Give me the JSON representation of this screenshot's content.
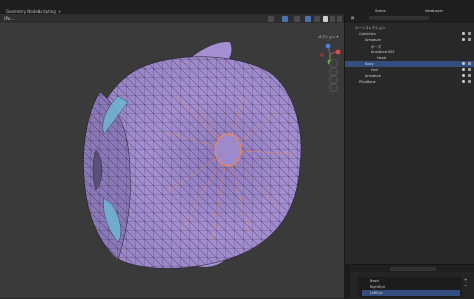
{
  "workspace_tabs": [
    "Geometry Nodes",
    "Scripting"
  ],
  "viewport": {
    "mode_label": "(Po...",
    "options_label": "オプション ▾",
    "axes": [
      "X",
      "Y",
      "Z"
    ]
  },
  "outliner": {
    "scene_label": "Scene",
    "view_layer_label": "ViewLayer",
    "header_label": "シーンコレクション",
    "rows": [
      {
        "label": "Collection",
        "indent": 0,
        "selected": false
      },
      {
        "label": "Armature",
        "indent": 1,
        "selected": false
      },
      {
        "label": "ポーズ",
        "indent": 2,
        "selected": false
      },
      {
        "label": "Armature.002",
        "indent": 2,
        "selected": false
      },
      {
        "label": "Head",
        "indent": 3,
        "selected": false
      },
      {
        "label": "Body",
        "indent": 1,
        "selected": true
      },
      {
        "label": "Hair",
        "indent": 2,
        "selected": false
      },
      {
        "label": "Armature",
        "indent": 1,
        "selected": false
      },
      {
        "label": "PhysBone",
        "indent": 0,
        "selected": false
      }
    ]
  },
  "properties": {
    "shape_keys": [
      {
        "label": "Basis",
        "selected": false
      },
      {
        "label": "RightEye",
        "selected": false
      },
      {
        "label": "LeftEye",
        "selected": true
      }
    ]
  },
  "colors": {
    "mesh": "#a58fd1",
    "wire": "#1e1a2a",
    "selection": "#ff8c2a",
    "accent": "#4772b3"
  }
}
